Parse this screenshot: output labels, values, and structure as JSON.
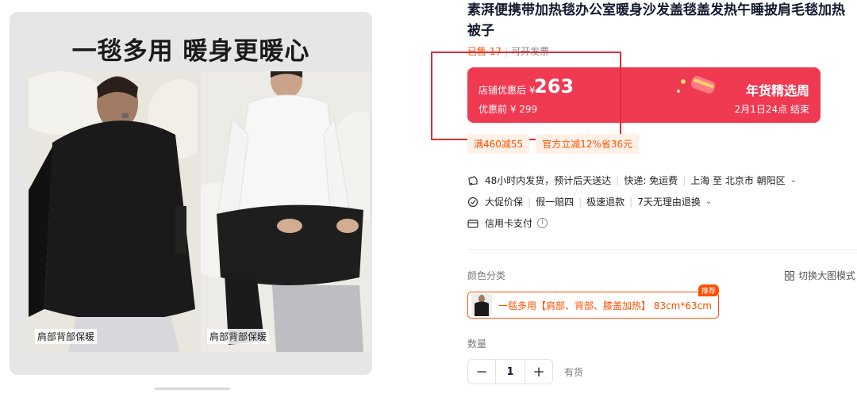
{
  "gallery": {
    "title": "一毯多用 暖身更暖心",
    "left_caption": "肩部背部保暖",
    "right_caption": "肩部背部保暖"
  },
  "product": {
    "title": "素湃便携带加热毯办公室暖身沙发盖毯盖发热午睡披肩毛毯加热被子",
    "sold": "已售 17",
    "invoice": "可开发票"
  },
  "price": {
    "label": "店铺优惠后 ¥",
    "value": "263",
    "before": "优惠前 ¥ 299",
    "promo_name": "年货精选周",
    "promo_time": "2月1日24点 结束"
  },
  "coupons": [
    "满460减55",
    "官方立减12%省36元"
  ],
  "services": {
    "shipping": "48小时内发货，预计后天送达",
    "express": "快递: 免运费",
    "route": "上海 至 北京市 朝阳区",
    "guarantees": [
      "大促价保",
      "假一赔四",
      "极速退款",
      "7天无理由退换"
    ],
    "payment": "信用卡支付"
  },
  "options": {
    "color_label": "颜色分类",
    "switch_mode": "切换大图模式",
    "sku_label": "一毯多用【肩部、背部、膝盖加热】 83cm*63cm",
    "sku_badge": "推荐",
    "quantity_label": "数量",
    "quantity": "1",
    "stock": "有货"
  },
  "colors": {
    "accent": "#ff5000",
    "price_bg": "#ef3a52",
    "highlight_frame": "#e42a38"
  }
}
